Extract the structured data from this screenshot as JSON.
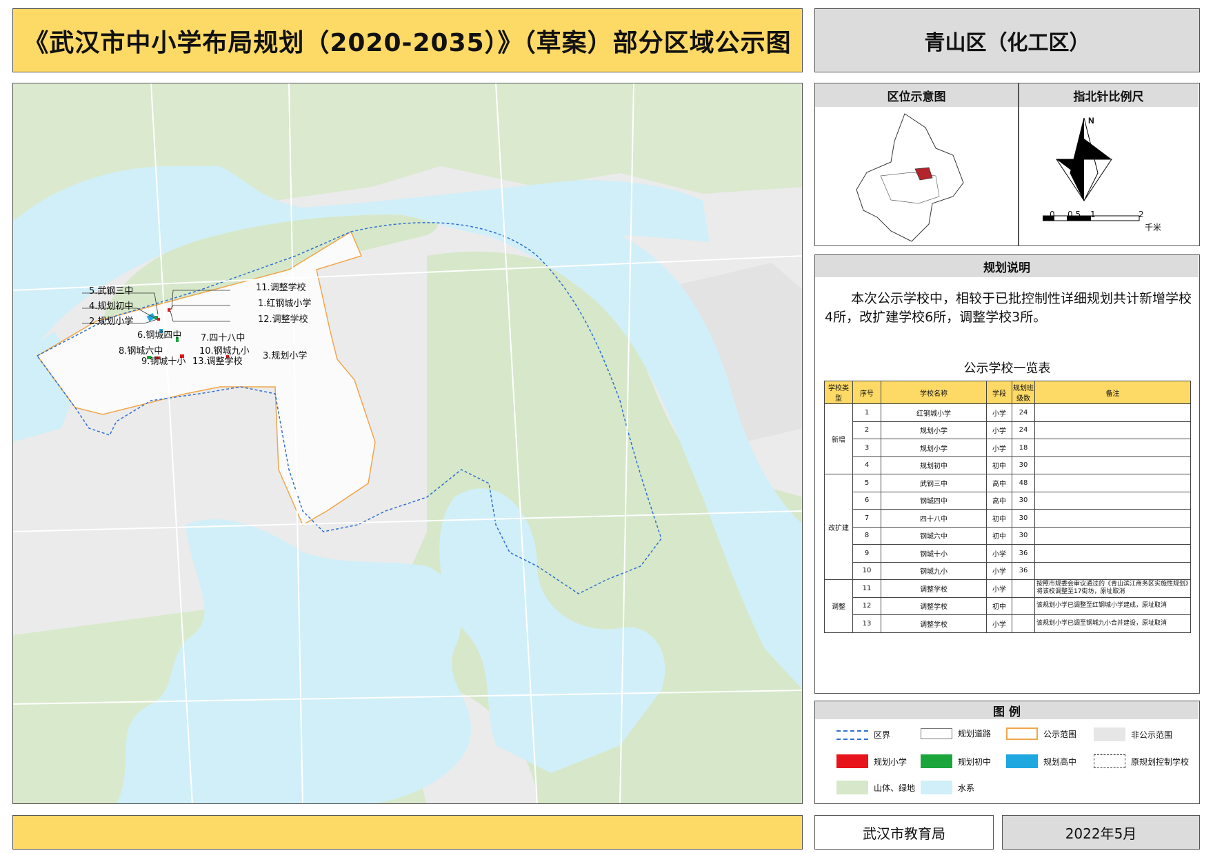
{
  "title": "《武汉市中小学布局规划（2020-2035）》（草案）部分区域公示图",
  "district": "青山区（化工区）",
  "map": {
    "labels": [
      {
        "id": "l5",
        "text": "5.武钢三中"
      },
      {
        "id": "l4",
        "text": "4.规划初中"
      },
      {
        "id": "l2",
        "text": "2.规划小学"
      },
      {
        "id": "l11",
        "text": "11.调整学校"
      },
      {
        "id": "l1",
        "text": "1.红钢城小学"
      },
      {
        "id": "l12",
        "text": "12.调整学校"
      },
      {
        "id": "l6",
        "text": "6.钢城四中"
      },
      {
        "id": "l7",
        "text": "7.四十八中"
      },
      {
        "id": "l8",
        "text": "8.钢城六中"
      },
      {
        "id": "l10",
        "text": "10.钢城九小"
      },
      {
        "id": "l3",
        "text": "3.规划小学"
      },
      {
        "id": "l9",
        "text": "9.钢城十小"
      },
      {
        "id": "l13",
        "text": "13.调整学校"
      }
    ]
  },
  "location": {
    "head_left": "区位示意图",
    "head_right": "指北针比例尺",
    "north": "N",
    "scale_ticks": [
      "0",
      "0.5",
      "1",
      "2"
    ],
    "scale_unit": "千米"
  },
  "plan": {
    "head": "规划说明",
    "description": "本次公示学校中，相较于已批控制性详细规划共计新增学校4所，改扩建学校6所，调整学校3所。",
    "table_title": "公示学校一览表",
    "columns": [
      "学校类型",
      "序号",
      "学校名称",
      "学段",
      "规划班级数",
      "备注"
    ],
    "groups": [
      {
        "type": "新增",
        "rows": [
          {
            "no": "1",
            "name": "红钢城小学",
            "stage": "小学",
            "classes": "24",
            "note": ""
          },
          {
            "no": "2",
            "name": "规划小学",
            "stage": "小学",
            "classes": "24",
            "note": ""
          },
          {
            "no": "3",
            "name": "规划小学",
            "stage": "小学",
            "classes": "18",
            "note": ""
          },
          {
            "no": "4",
            "name": "规划初中",
            "stage": "初中",
            "classes": "30",
            "note": ""
          }
        ]
      },
      {
        "type": "改扩建",
        "rows": [
          {
            "no": "5",
            "name": "武钢三中",
            "stage": "高中",
            "classes": "48",
            "note": ""
          },
          {
            "no": "6",
            "name": "钢城四中",
            "stage": "高中",
            "classes": "30",
            "note": ""
          },
          {
            "no": "7",
            "name": "四十八中",
            "stage": "初中",
            "classes": "30",
            "note": ""
          },
          {
            "no": "8",
            "name": "钢城六中",
            "stage": "初中",
            "classes": "30",
            "note": ""
          },
          {
            "no": "9",
            "name": "钢城十小",
            "stage": "小学",
            "classes": "36",
            "note": ""
          },
          {
            "no": "10",
            "name": "钢城九小",
            "stage": "小学",
            "classes": "36",
            "note": ""
          }
        ]
      },
      {
        "type": "调整",
        "rows": [
          {
            "no": "11",
            "name": "调整学校",
            "stage": "小学",
            "classes": "",
            "note": "按照市规委会审议通过的《青山滨江商务区实施性规划》将该校调整至17街坊，原址取消"
          },
          {
            "no": "12",
            "name": "调整学校",
            "stage": "初中",
            "classes": "",
            "note": "该规划小学已调整至红钢城小学建成，原址取消"
          },
          {
            "no": "13",
            "name": "调整学校",
            "stage": "小学",
            "classes": "",
            "note": "该规划小学已调至钢城九小合并建设，原址取消"
          }
        ]
      }
    ]
  },
  "legend": {
    "head": "图  例",
    "items": [
      {
        "key": "district-boundary",
        "label": "区界"
      },
      {
        "key": "planned-road",
        "label": "规划道路"
      },
      {
        "key": "publicity-scope",
        "label": "公示范围"
      },
      {
        "key": "non-publicity-scope",
        "label": "非公示范围"
      },
      {
        "key": "planned-primary",
        "label": "规划小学"
      },
      {
        "key": "planned-junior",
        "label": "规划初中"
      },
      {
        "key": "planned-senior",
        "label": "规划高中"
      },
      {
        "key": "original-school",
        "label": "原规划控制学校"
      },
      {
        "key": "greenland",
        "label": "山体、绿地"
      },
      {
        "key": "water",
        "label": "水系"
      }
    ],
    "colors": {
      "primary": "#e8141b",
      "junior": "#1ba53a",
      "senior": "#1fa7e0",
      "green": "#d6e8c9",
      "water": "#d1eff8",
      "nonscope": "#e6e6e6",
      "scope": "#f0a64a",
      "boundary": "#2f6fd0"
    }
  },
  "footer": {
    "bureau": "武汉市教育局",
    "date": "2022年5月"
  }
}
